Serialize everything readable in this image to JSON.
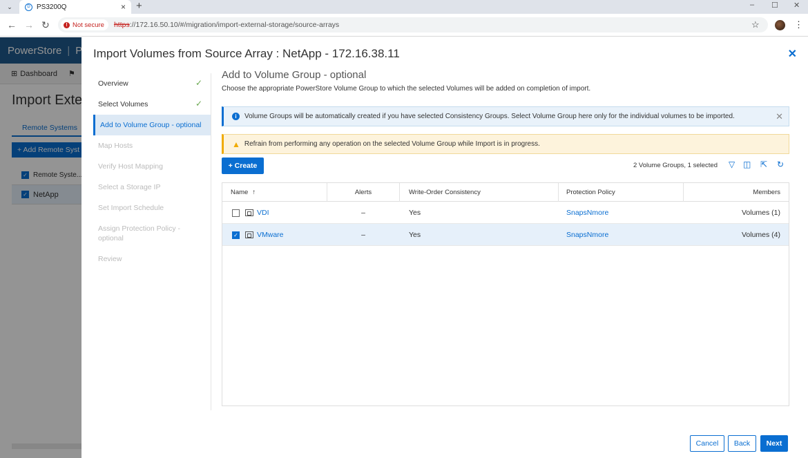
{
  "browser": {
    "tab_title": "PS3200Q",
    "not_secure": "Not secure",
    "url_scheme": "https",
    "url_rest": "://172.16.50.10/#/migration/import-external-storage/source-arrays"
  },
  "background": {
    "brand": "PowerStore",
    "brand_trunc": "PS",
    "nav_dashboard": "Dashboard",
    "page_title": "Import Exte",
    "tab_remote": "Remote Systems",
    "add_btn": "+ Add Remote Syst",
    "rows": [
      "Remote Syste...",
      "NetApp"
    ]
  },
  "modal": {
    "title": "Import Volumes from Source Array : NetApp - 172.16.38.11",
    "steps": [
      {
        "label": "Overview",
        "state": "done"
      },
      {
        "label": "Select Volumes",
        "state": "done"
      },
      {
        "label": "Add to Volume Group - optional",
        "state": "active"
      },
      {
        "label": "Map Hosts",
        "state": "pending"
      },
      {
        "label": "Verify Host Mapping",
        "state": "pending"
      },
      {
        "label": "Select a Storage IP",
        "state": "pending"
      },
      {
        "label": "Set Import Schedule",
        "state": "pending"
      },
      {
        "label": "Assign Protection Policy - optional",
        "state": "pending"
      },
      {
        "label": "Review",
        "state": "pending"
      }
    ],
    "content": {
      "title": "Add to Volume Group - optional",
      "subtitle": "Choose the appropriate PowerStore Volume Group to which the selected Volumes will be added on completion of import.",
      "info_banner": "Volume Groups will be automatically created if you have selected Consistency Groups. Select Volume Group here only for the individual volumes to be imported.",
      "warn_banner": "Refrain from performing any operation on the selected Volume Group while Import is in progress.",
      "create_btn": "+ Create",
      "summary": "2 Volume Groups, 1 selected",
      "columns": [
        "Name",
        "Alerts",
        "Write-Order Consistency",
        "Protection Policy",
        "Members"
      ],
      "sort_indicator": "↑",
      "rows": [
        {
          "name": "VDI",
          "alerts": "–",
          "woc": "Yes",
          "policy": "SnapsNmore",
          "members": "Volumes (1)",
          "selected": false
        },
        {
          "name": "VMware",
          "alerts": "–",
          "woc": "Yes",
          "policy": "SnapsNmore",
          "members": "Volumes (4)",
          "selected": true
        }
      ]
    },
    "footer": {
      "cancel": "Cancel",
      "back": "Back",
      "next": "Next"
    }
  },
  "colors": {
    "accent": "#0a6ed1",
    "success": "#6aa84f",
    "warning": "#f0ab00"
  }
}
